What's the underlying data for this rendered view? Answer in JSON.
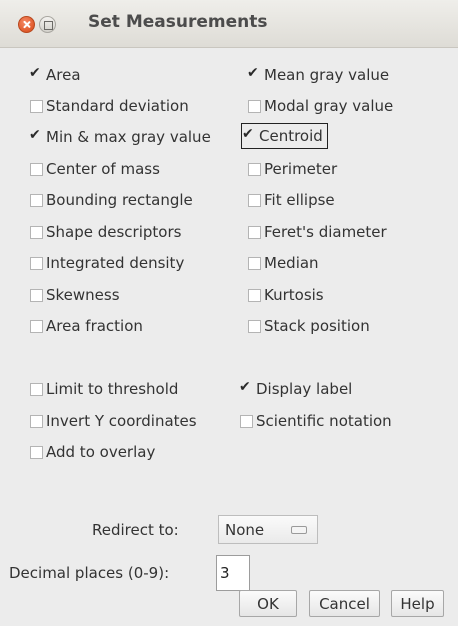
{
  "window": {
    "title": "Set Measurements"
  },
  "options_left": [
    {
      "label": "Area",
      "checked": true
    },
    {
      "label": "Standard deviation",
      "checked": false
    },
    {
      "label": "Min & max gray value",
      "checked": true
    },
    {
      "label": "Center of mass",
      "checked": false
    },
    {
      "label": "Bounding rectangle",
      "checked": false
    },
    {
      "label": "Shape descriptors",
      "checked": false
    },
    {
      "label": "Integrated density",
      "checked": false
    },
    {
      "label": "Skewness",
      "checked": false
    },
    {
      "label": "Area fraction",
      "checked": false
    }
  ],
  "options_right": [
    {
      "label": "Mean gray value",
      "checked": true
    },
    {
      "label": "Modal gray value",
      "checked": false
    },
    {
      "label": "Centroid",
      "checked": true
    },
    {
      "label": "Perimeter",
      "checked": false
    },
    {
      "label": "Fit ellipse",
      "checked": false
    },
    {
      "label": "Feret's diameter",
      "checked": false
    },
    {
      "label": "Median",
      "checked": false
    },
    {
      "label": "Kurtosis",
      "checked": false
    },
    {
      "label": "Stack position",
      "checked": false
    }
  ],
  "extra_left": [
    {
      "label": "Limit to threshold",
      "checked": false
    },
    {
      "label": "Invert Y coordinates",
      "checked": false
    },
    {
      "label": "Add to overlay",
      "checked": false
    }
  ],
  "extra_right": [
    {
      "label": "Display label",
      "checked": true
    },
    {
      "label": "Scientific notation",
      "checked": false
    }
  ],
  "redirect": {
    "label": "Redirect to:",
    "value": "None"
  },
  "decimal": {
    "label": "Decimal places (0-9):",
    "value": "3"
  },
  "buttons": {
    "ok": "OK",
    "cancel": "Cancel",
    "help": "Help"
  }
}
